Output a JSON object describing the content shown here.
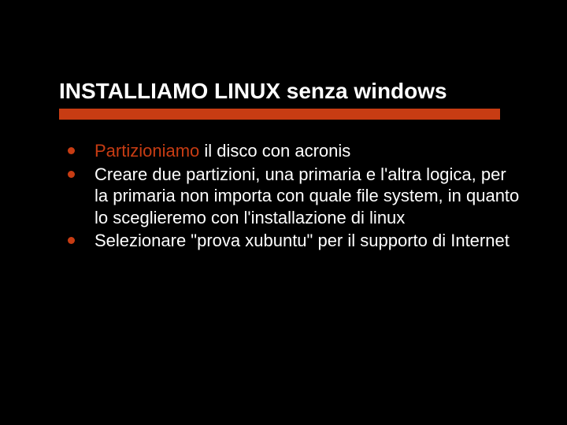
{
  "slide": {
    "title": "INSTALLIAMO LINUX senza windows",
    "bullets": [
      {
        "highlight": "Partizioniamo",
        "rest": " il disco con acronis"
      },
      {
        "text": "Creare due partizioni, una primaria e l'altra logica, per la primaria non importa con quale file system, in quanto lo sceglieremo con l'installazione di linux"
      },
      {
        "text": "Selezionare \"prova xubuntu\" per il supporto di Internet"
      }
    ]
  },
  "colors": {
    "background": "#000000",
    "text": "#ffffff",
    "accent": "#c73c13"
  }
}
